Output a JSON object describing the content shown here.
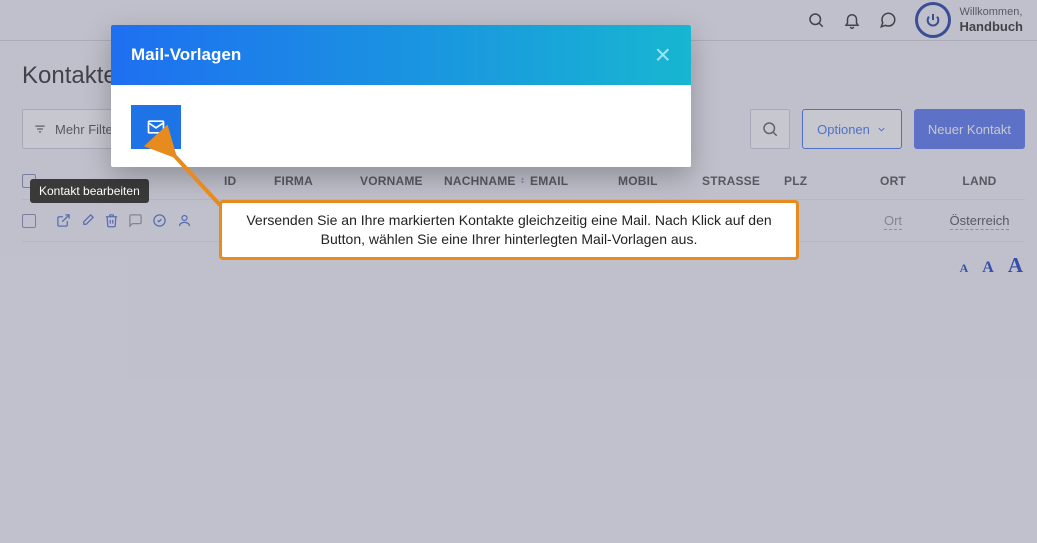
{
  "topbar": {
    "welcome_label": "Willkommen,",
    "welcome_name": "Handbuch"
  },
  "page_title": "Kontakte",
  "toolbar": {
    "filter_label": "Mehr Filter",
    "options_label": "Optionen",
    "new_label": "Neuer Kontakt"
  },
  "table": {
    "headers": {
      "id": "ID",
      "firma": "FIRMA",
      "vorname": "VORNAME",
      "nachname": "NACHNAME",
      "email": "EMAIL",
      "mobil": "MOBIL",
      "strasse": "STRASSE",
      "plz": "PLZ",
      "ort": "ORT",
      "land": "LAND"
    },
    "row": {
      "ort": "Ort",
      "land": "Österreich"
    }
  },
  "tooltip": "Kontakt bearbeiten",
  "font_controls": {
    "a1": "A",
    "a2": "A",
    "a3": "A"
  },
  "modal": {
    "title": "Mail-Vorlagen"
  },
  "callout": "Versenden Sie an Ihre markierten Kontakte gleichzeitig eine Mail. Nach Klick auf den Button, wählen Sie eine Ihrer hinterlegten Mail-Vorlagen aus."
}
